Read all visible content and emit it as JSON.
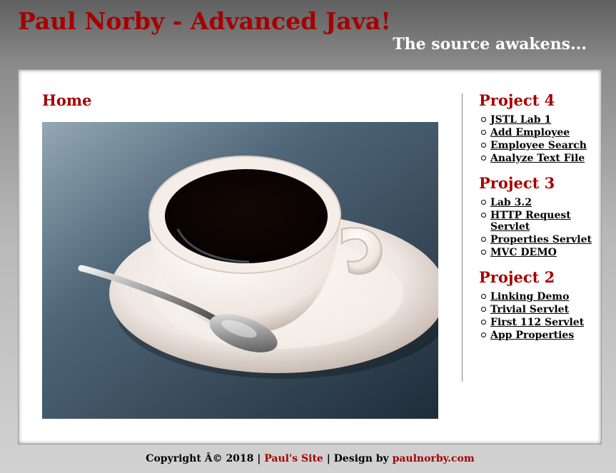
{
  "header": {
    "title": "Paul Norby - Advanced Java!",
    "tagline": "The source awakens..."
  },
  "main": {
    "heading": "Home",
    "image_icon": "coffee-cup-image"
  },
  "sidebar": {
    "sections": [
      {
        "heading": "Project 4",
        "links": [
          "JSTL Lab 1",
          "Add Employee",
          "Employee Search",
          "Analyze Text File"
        ]
      },
      {
        "heading": "Project 3",
        "links": [
          "Lab 3.2",
          "HTTP Request Servlet",
          "Properties Servlet",
          "MVC DEMO"
        ]
      },
      {
        "heading": "Project 2",
        "links": [
          "Linking Demo",
          "Trivial Servlet",
          "First 112 Servlet",
          "App Properties"
        ]
      }
    ]
  },
  "footer": {
    "copyright": "Copyright Â© 2018 |",
    "site_link": "Paul's Site",
    "design_text": "| Design by",
    "designer_link": "paulnorby.com"
  },
  "colors": {
    "accent": "#a50000",
    "content_bg": "#ffffff"
  }
}
